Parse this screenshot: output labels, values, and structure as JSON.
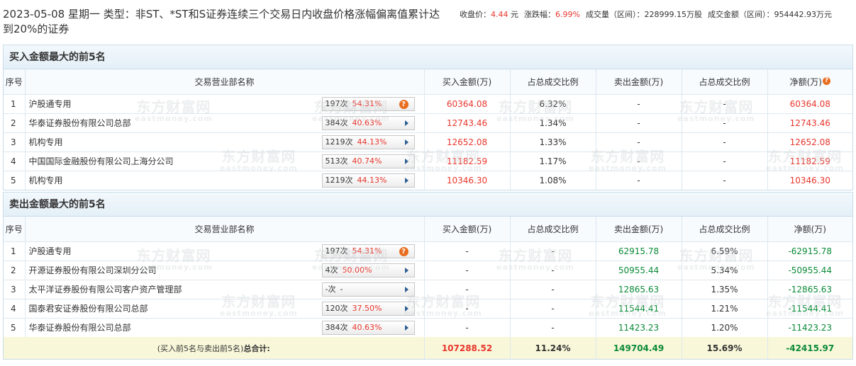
{
  "header": {
    "title": "2023-05-08 星期一 类型：非ST、*ST和S证券连续三个交易日内收盘价格涨幅偏离值累计达到20%的证券",
    "close_label": "收盘价：",
    "close_value": "4.44",
    "close_unit": "元",
    "change_label": "涨跌幅：",
    "change_value": "6.99%",
    "volume_label": "成交量（区间）：",
    "volume_value": "228999.15万股",
    "amount_label": "成交金额（区间）：",
    "amount_value": "954442.93万元"
  },
  "watermark": {
    "cn": "东方财富网",
    "en": "eastmoney.com"
  },
  "buy_table": {
    "title": "买入金额最大的前5名",
    "columns": [
      "序号",
      "交易营业部名称",
      "买入金额(万)",
      "占总成交比例",
      "卖出金额(万)",
      "占总成交比例",
      "净额(万)"
    ],
    "rows": [
      {
        "rank": "1",
        "name": "沪股通专用",
        "times": "197次",
        "pct": "54.31%",
        "icon": "question-icon",
        "buy": "60364.08",
        "buy_ratio": "6.32%",
        "sell": "-",
        "sell_ratio": "-",
        "net": "60364.08"
      },
      {
        "rank": "2",
        "name": "华泰证券股份有限公司总部",
        "times": "384次",
        "pct": "40.63%",
        "icon": "arrow-right-icon",
        "buy": "12743.46",
        "buy_ratio": "1.34%",
        "sell": "-",
        "sell_ratio": "-",
        "net": "12743.46"
      },
      {
        "rank": "3",
        "name": "机构专用",
        "times": "1219次",
        "pct": "44.13%",
        "icon": "arrow-right-icon",
        "buy": "12652.08",
        "buy_ratio": "1.33%",
        "sell": "-",
        "sell_ratio": "-",
        "net": "12652.08"
      },
      {
        "rank": "4",
        "name": "中国国际金融股份有限公司上海分公司",
        "times": "513次",
        "pct": "40.74%",
        "icon": "arrow-right-icon",
        "buy": "11182.59",
        "buy_ratio": "1.17%",
        "sell": "-",
        "sell_ratio": "-",
        "net": "11182.59"
      },
      {
        "rank": "5",
        "name": "机构专用",
        "times": "1219次",
        "pct": "44.13%",
        "icon": "arrow-right-icon",
        "buy": "10346.30",
        "buy_ratio": "1.08%",
        "sell": "-",
        "sell_ratio": "-",
        "net": "10346.30"
      }
    ]
  },
  "sell_table": {
    "title": "卖出金额最大的前5名",
    "columns": [
      "序号",
      "交易营业部名称",
      "买入金额(万)",
      "占总成交比例",
      "卖出金额(万)",
      "占总成交比例",
      "净额(万)"
    ],
    "rows": [
      {
        "rank": "1",
        "name": "沪股通专用",
        "times": "197次",
        "pct": "54.31%",
        "icon": "question-icon",
        "buy": "-",
        "buy_ratio": "-",
        "sell": "62915.78",
        "sell_ratio": "6.59%",
        "net": "-62915.78"
      },
      {
        "rank": "2",
        "name": "开源证券股份有限公司深圳分公司",
        "times": "4次",
        "pct": "50.00%",
        "icon": "arrow-right-icon",
        "buy": "-",
        "buy_ratio": "-",
        "sell": "50955.44",
        "sell_ratio": "5.34%",
        "net": "-50955.44"
      },
      {
        "rank": "3",
        "name": "太平洋证券股份有限公司客户资产管理部",
        "times": "-次",
        "pct": "-",
        "icon": "arrow-right-icon",
        "buy": "-",
        "buy_ratio": "-",
        "sell": "12865.63",
        "sell_ratio": "1.35%",
        "net": "-12865.63"
      },
      {
        "rank": "4",
        "name": "国泰君安证券股份有限公司总部",
        "times": "120次",
        "pct": "37.50%",
        "icon": "arrow-right-icon",
        "buy": "-",
        "buy_ratio": "-",
        "sell": "11544.41",
        "sell_ratio": "1.21%",
        "net": "-11544.41"
      },
      {
        "rank": "5",
        "name": "华泰证券股份有限公司总部",
        "times": "384次",
        "pct": "40.63%",
        "icon": "arrow-right-icon",
        "buy": "-",
        "buy_ratio": "-",
        "sell": "11423.23",
        "sell_ratio": "1.20%",
        "net": "-11423.23"
      }
    ],
    "total": {
      "label_prefix": "(买入前5名与卖出前5名)",
      "label_bold": "总合计:",
      "buy": "107288.52",
      "buy_ratio": "11.24%",
      "sell": "149704.49",
      "sell_ratio": "15.69%",
      "net": "-42415.97"
    }
  },
  "colors": {
    "up": "#e8362c",
    "down": "#0a8a38",
    "panel_border": "#c9dde9",
    "total_bg": "#f9f7d9"
  }
}
